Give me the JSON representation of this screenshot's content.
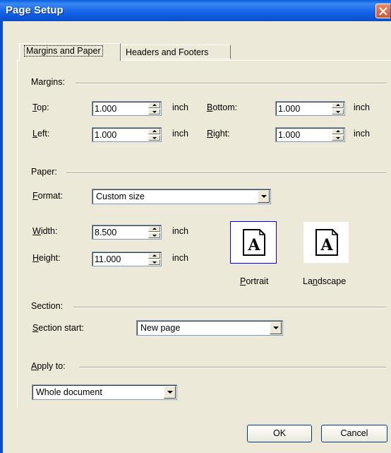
{
  "window": {
    "title": "Page Setup"
  },
  "tabs": [
    {
      "label": "Margins and Paper",
      "active": true
    },
    {
      "label": "Headers and Footers",
      "active": false
    }
  ],
  "margins": {
    "group_label": "Margins:",
    "top": {
      "label_u": "T",
      "label_rest": "op:",
      "value": "1.000",
      "unit": "inch"
    },
    "left": {
      "label_u": "L",
      "label_rest": "eft:",
      "value": "1.000",
      "unit": "inch"
    },
    "bottom": {
      "label_u": "B",
      "label_rest": "ottom:",
      "value": "1.000",
      "unit": "inch"
    },
    "right": {
      "label_u": "R",
      "label_rest": "ight:",
      "value": "1.000",
      "unit": "inch"
    }
  },
  "paper": {
    "group_label": "Paper:",
    "format": {
      "label_u": "F",
      "label_rest": "ormat:",
      "value": "Custom size"
    },
    "width": {
      "label_u": "W",
      "label_rest": "idth:",
      "value": "8.500",
      "unit": "inch"
    },
    "height": {
      "label_u": "H",
      "label_rest": "eight:",
      "value": "11.000",
      "unit": "inch"
    },
    "portrait": {
      "label_u": "P",
      "label_rest": "ortrait",
      "glyph": "A",
      "selected": true
    },
    "landscape": {
      "label_pre": "La",
      "label_u": "n",
      "label_rest": "dscape",
      "glyph": "A",
      "selected": false
    }
  },
  "section": {
    "group_label": "Section:",
    "start": {
      "label_u": "S",
      "label_rest": "ection start:",
      "value": "New page"
    }
  },
  "apply": {
    "label_u": "A",
    "label_rest": "pply to:",
    "value": "Whole document"
  },
  "buttons": {
    "ok": "OK",
    "cancel": "Cancel"
  },
  "colors": {
    "titlebar": "#0a5fde",
    "face": "#ece9d8",
    "selection": "#0000ff"
  }
}
